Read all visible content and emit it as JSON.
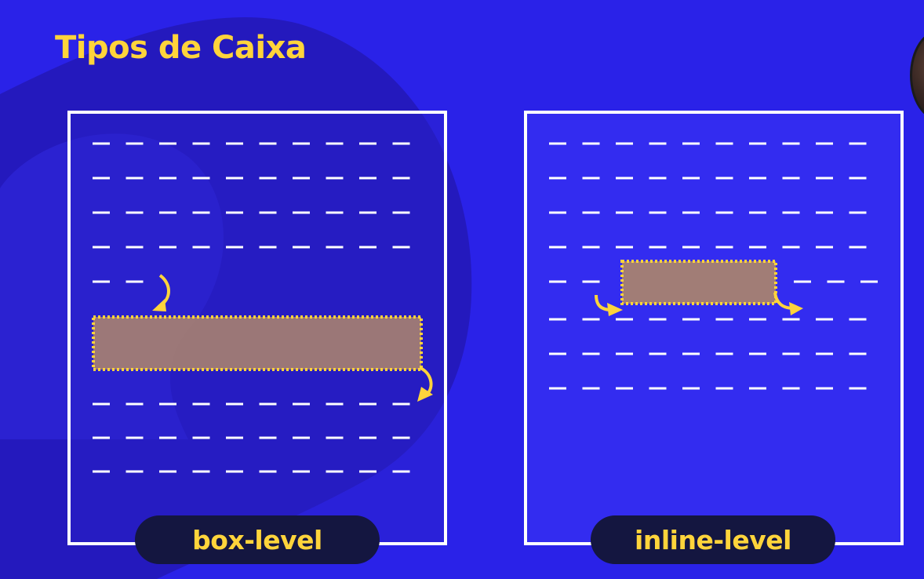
{
  "title": "Tipos de Caixa",
  "colors": {
    "background": "#2a22e8",
    "accent": "#ffd43b",
    "dash": "#ffffff",
    "badge_bg": "#141640",
    "box_fill": "#a8826f"
  },
  "panels": [
    {
      "label": "box-level",
      "element_type": "block"
    },
    {
      "label": "inline-level",
      "element_type": "inline"
    }
  ]
}
